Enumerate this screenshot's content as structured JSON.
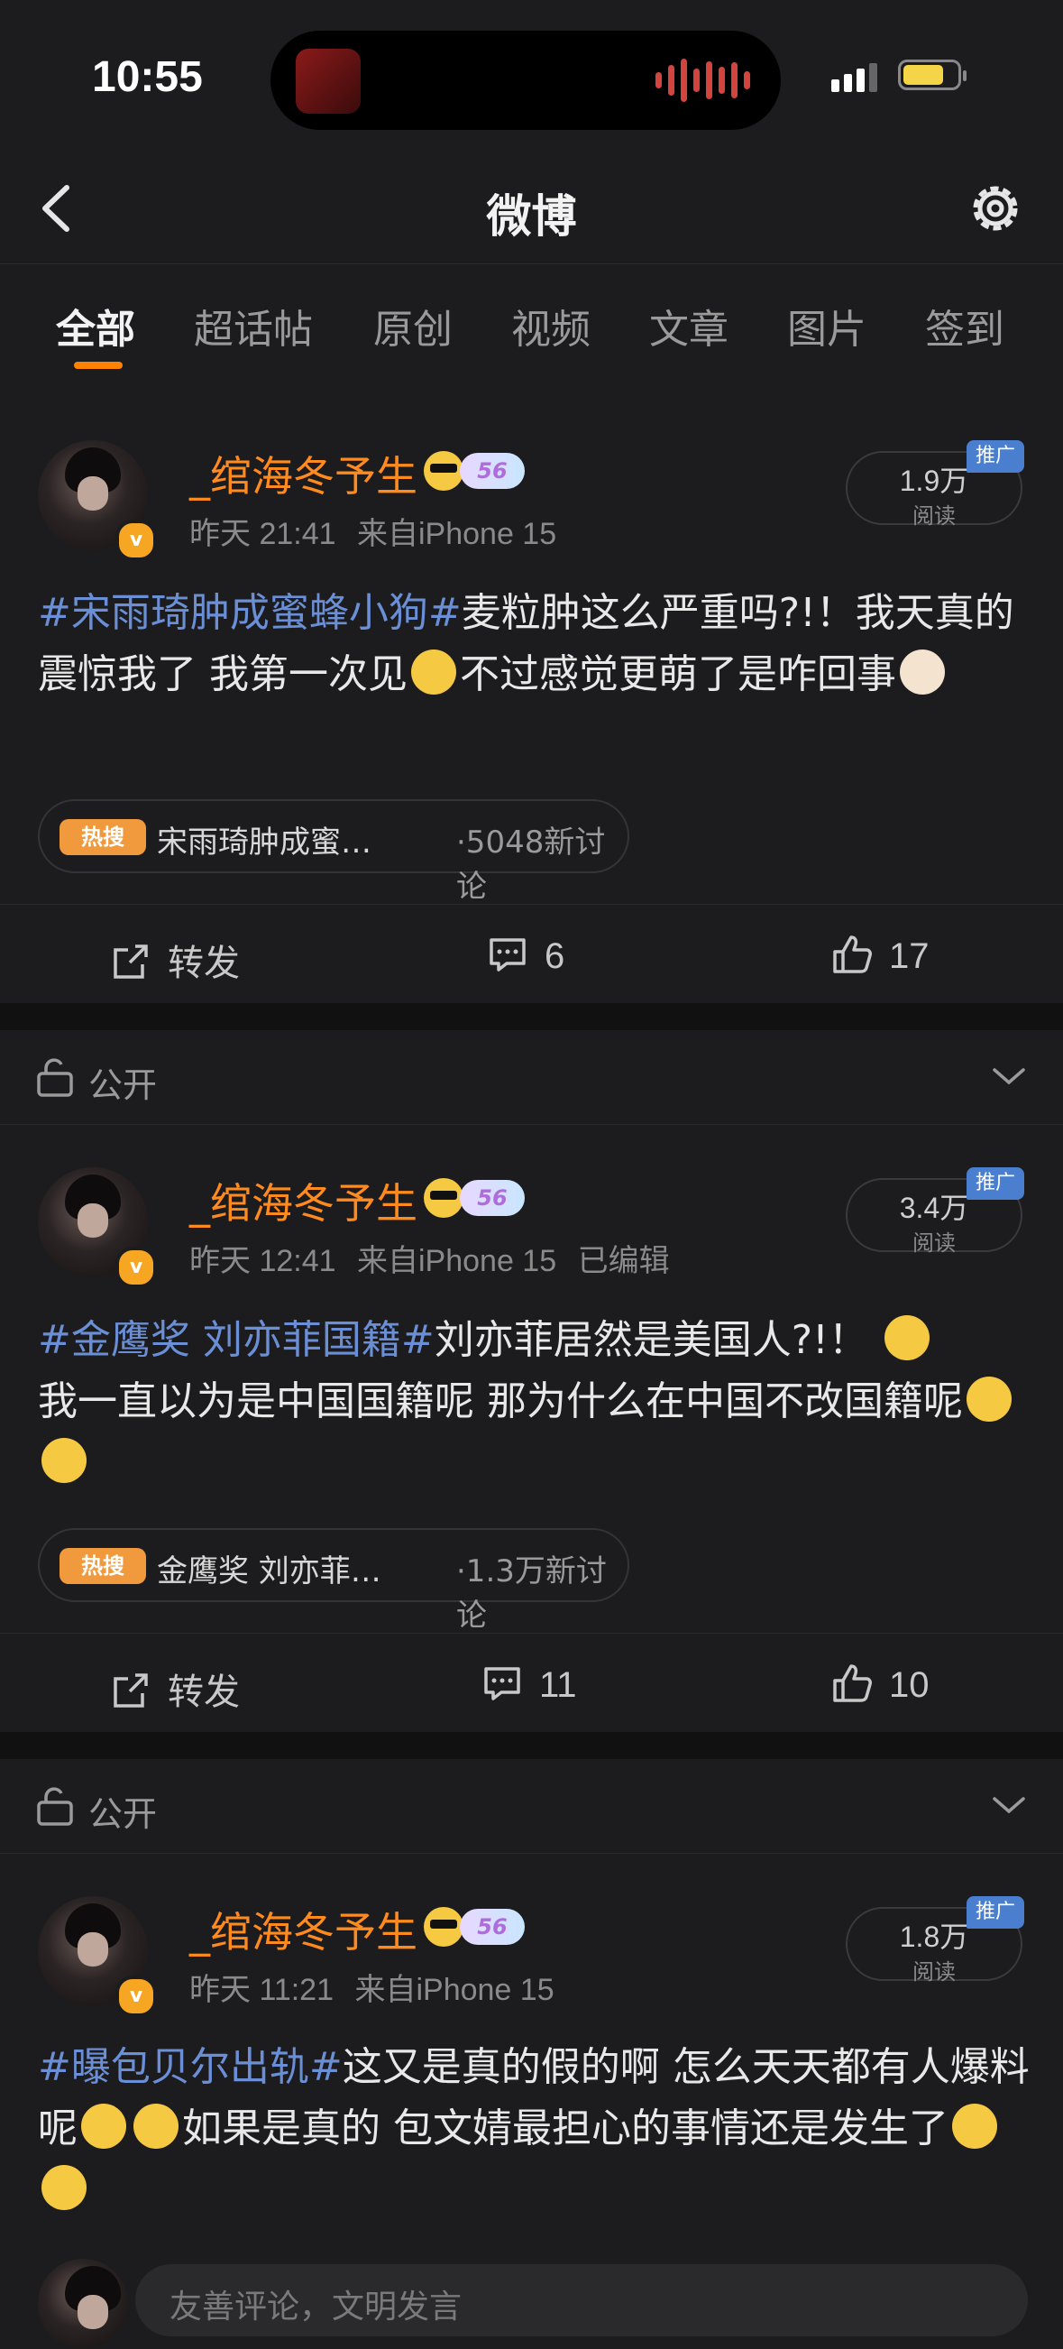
{
  "status_bar": {
    "time": "10:55",
    "island_app_icon": "live-app-icon",
    "island_activity": "audio-wave-icon",
    "battery_color": "#f5d548"
  },
  "nav": {
    "title": "微博",
    "back_icon": "back-chevron-icon",
    "settings_icon": "gear-icon"
  },
  "tabs": [
    {
      "label": "全部",
      "active": true
    },
    {
      "label": "超话帖"
    },
    {
      "label": "原创"
    },
    {
      "label": "视频"
    },
    {
      "label": "文章"
    },
    {
      "label": "图片"
    },
    {
      "label": "签到"
    }
  ],
  "accent_color": "#ff8200",
  "posts": [
    {
      "username": "_绾海冬予生",
      "level": "56",
      "time": "昨天 21:41",
      "source": "来自iPhone 15",
      "edited": "",
      "reads_count": "1.9万",
      "reads_label": "阅读",
      "promo_label": "推广",
      "topic": "#宋雨琦肿成蜜蜂小狗#",
      "text_1": "麦粒肿这么严重吗?!！我天真的震惊我了 我第一次见",
      "text_2": "不过感觉更萌了是咋回事",
      "hot_tag": "热搜",
      "hot_title": "宋雨琦肿成蜜…",
      "hot_count": "·5048新讨论",
      "repost_label": "转发",
      "comments": "6",
      "likes": "17"
    },
    {
      "privacy": "公开",
      "username": "_绾海冬予生",
      "level": "56",
      "time": "昨天 12:41",
      "source": "来自iPhone 15",
      "edited": "已编辑",
      "reads_count": "3.4万",
      "reads_label": "阅读",
      "promo_label": "推广",
      "topic": "#金鹰奖 刘亦菲国籍#",
      "text_1": "刘亦菲居然是美国人?!！",
      "text_2": "我一直以为是中国国籍呢 那为什么在中国不改国籍呢",
      "hot_tag": "热搜",
      "hot_title": "金鹰奖 刘亦菲…",
      "hot_count": "·1.3万新讨论",
      "repost_label": "转发",
      "comments": "11",
      "likes": "10"
    },
    {
      "privacy": "公开",
      "username": "_绾海冬予生",
      "level": "56",
      "time": "昨天 11:21",
      "source": "来自iPhone 15",
      "reads_count": "1.8万",
      "reads_label": "阅读",
      "promo_label": "推广",
      "topic": "#曝包贝尔出轨#",
      "text_1": "这又是真的假的啊 怎么天天都有人爆料呢",
      "text_2": "如果是真的 包文婧最担心的事情还是发生了"
    }
  ],
  "comment_bar": {
    "placeholder": "友善评论，文明发言"
  }
}
